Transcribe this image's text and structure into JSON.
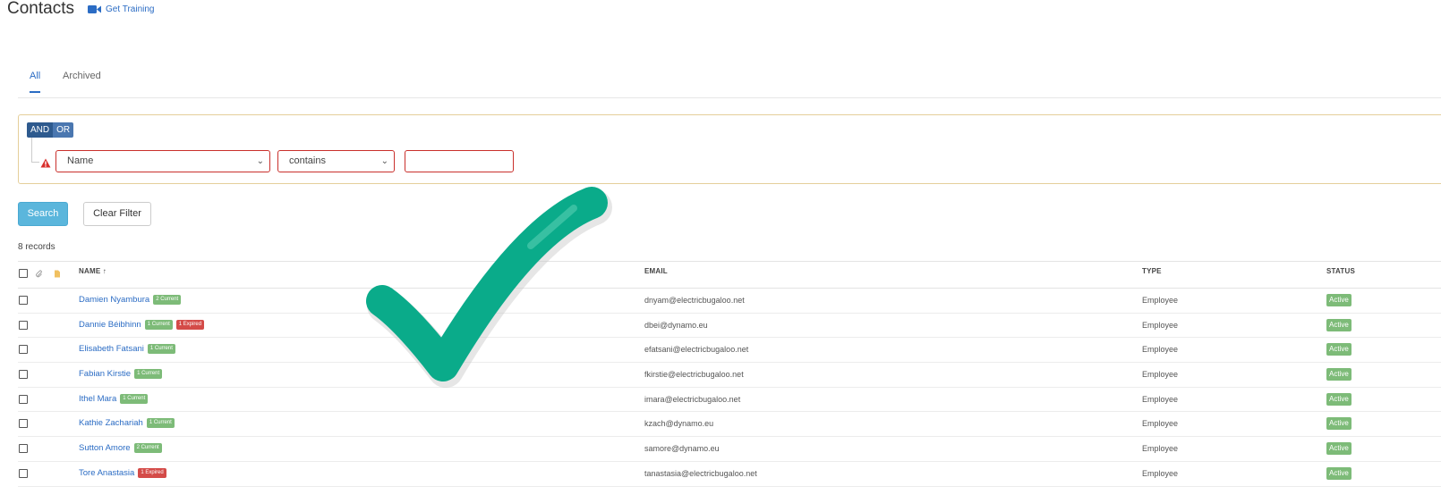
{
  "header": {
    "title": "Contacts",
    "training_link": "Get Training",
    "training_icon": "video-camera-icon"
  },
  "tabs": [
    {
      "label": "All",
      "active": true
    },
    {
      "label": "Archived",
      "active": false
    }
  ],
  "filter": {
    "logic": {
      "and_label": "AND",
      "or_label": "OR",
      "selected": "AND"
    },
    "field": "Name",
    "operator": "contains",
    "value": "",
    "warning_icon": "warning-triangle-icon"
  },
  "buttons": {
    "search": "Search",
    "clear": "Clear Filter"
  },
  "records_count": "8 records",
  "table": {
    "columns": {
      "name": "NAME ↑",
      "email": "EMAIL",
      "type": "TYPE",
      "status": "STATUS"
    },
    "header_icons": [
      "paperclip-icon",
      "document-icon"
    ],
    "rows": [
      {
        "name": "Damien Nyambura",
        "badges": [
          {
            "text": "2 Current",
            "kind": "current"
          }
        ],
        "email": "dnyam@electricbugaloo.net",
        "type": "Employee",
        "status": "Active"
      },
      {
        "name": "Dannie Béibhinn",
        "badges": [
          {
            "text": "1 Current",
            "kind": "current"
          },
          {
            "text": "1 Expired",
            "kind": "expired"
          }
        ],
        "email": "dbei@dynamo.eu",
        "type": "Employee",
        "status": "Active"
      },
      {
        "name": "Elisabeth Fatsani",
        "badges": [
          {
            "text": "1 Current",
            "kind": "current"
          }
        ],
        "email": "efatsani@electricbugaloo.net",
        "type": "Employee",
        "status": "Active"
      },
      {
        "name": "Fabian Kirstie",
        "badges": [
          {
            "text": "1 Current",
            "kind": "current"
          }
        ],
        "email": "fkirstie@electricbugaloo.net",
        "type": "Employee",
        "status": "Active"
      },
      {
        "name": "Ithel Mara",
        "badges": [
          {
            "text": "1 Current",
            "kind": "current"
          }
        ],
        "email": "imara@electricbugaloo.net",
        "type": "Employee",
        "status": "Active"
      },
      {
        "name": "Kathie Zachariah",
        "badges": [
          {
            "text": "1 Current",
            "kind": "current"
          }
        ],
        "email": "kzach@dynamo.eu",
        "type": "Employee",
        "status": "Active"
      },
      {
        "name": "Sutton Amore",
        "badges": [
          {
            "text": "2 Current",
            "kind": "current"
          }
        ],
        "email": "samore@dynamo.eu",
        "type": "Employee",
        "status": "Active"
      },
      {
        "name": "Tore Anastasia",
        "badges": [
          {
            "text": "1 Expired",
            "kind": "expired"
          }
        ],
        "email": "tanastasia@electricbugaloo.net",
        "type": "Employee",
        "status": "Active"
      }
    ]
  },
  "overlay": {
    "icon": "checkmark-icon",
    "color": "#0aab8a"
  },
  "colors": {
    "link": "#2b6cc4",
    "primary_button": "#5bb6dc",
    "current_badge": "#7dbb78",
    "expired_badge": "#d44b48",
    "error_border": "#c9302c"
  }
}
